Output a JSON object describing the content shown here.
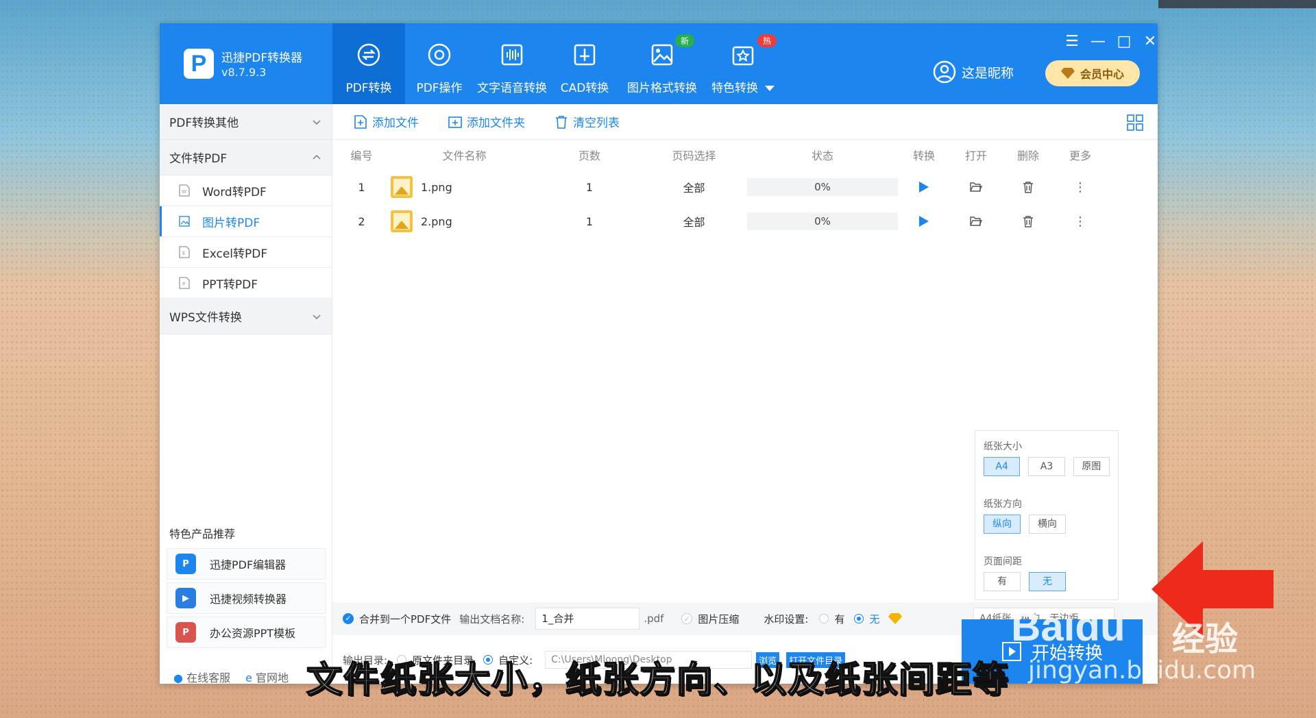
{
  "app": {
    "name": "迅捷PDF转换器",
    "version": "v8.7.9.3"
  },
  "nav": [
    {
      "label": "PDF转换",
      "icon": "pdf-convert-icon",
      "active": true
    },
    {
      "label": "PDF操作",
      "icon": "pdf-operate-icon"
    },
    {
      "label": "文字语音转换",
      "icon": "voice-icon"
    },
    {
      "label": "CAD转换",
      "icon": "cad-icon"
    },
    {
      "label": "图片格式转换",
      "icon": "image-icon",
      "badge": "新"
    },
    {
      "label": "特色转换",
      "icon": "feature-icon",
      "badge": "热"
    }
  ],
  "user": {
    "name": "这是昵称",
    "vip": "会员中心"
  },
  "sidebar": {
    "sections": [
      {
        "label": "PDF转换其他"
      },
      {
        "label": "文件转PDF",
        "items": [
          "Word转PDF",
          "图片转PDF",
          "Excel转PDF",
          "PPT转PDF"
        ]
      },
      {
        "label": "WPS文件转换"
      }
    ],
    "featured_title": "特色产品推荐",
    "featured": [
      "迅捷PDF编辑器",
      "迅捷视频转换器",
      "办公资源PPT模板"
    ],
    "links": [
      "在线客服",
      "官网地"
    ]
  },
  "toolbar": {
    "add_file": "添加文件",
    "add_folder": "添加文件夹",
    "clear": "清空列表"
  },
  "table": {
    "headers": [
      "编号",
      "文件名称",
      "页数",
      "页码选择",
      "状态",
      "转换",
      "打开",
      "删除",
      "更多"
    ],
    "rows": [
      {
        "no": "1",
        "name": "1.png",
        "pages": "1",
        "range": "全部",
        "status": "0%"
      },
      {
        "no": "2",
        "name": "2.png",
        "pages": "1",
        "range": "全部",
        "status": "0%"
      }
    ]
  },
  "paper": {
    "size_label": "纸张大小",
    "sizes": [
      "A4",
      "A3",
      "原图"
    ],
    "orient_label": "纸张方向",
    "orients": [
      "纵向",
      "横向"
    ],
    "margin_label": "页面间距",
    "margins": [
      "有",
      "无"
    ]
  },
  "options": {
    "merge": "合并到一个PDF文件",
    "out_name_label": "输出文档名称:",
    "out_name": "1_合并",
    "ext": ".pdf",
    "compress": "图片压缩",
    "watermark_label": "水印设置:",
    "wm_yes": "有",
    "wm_no": "无",
    "summary": "A4纸张，纵向，无边距"
  },
  "output": {
    "label": "输出目录:",
    "orig": "原文件夹目录",
    "custom": "自定义:",
    "path": "C:\\Users\\Mloong\\Desktop",
    "browse": "浏览",
    "open_dir": "打开文件目录"
  },
  "start": "开始转换",
  "watermark": {
    "logo": "Baidu",
    "jingyan": "经验",
    "url": "jingyan.baidu.com"
  },
  "caption": "文件纸张大小，纸张方向、以及纸张间距等"
}
